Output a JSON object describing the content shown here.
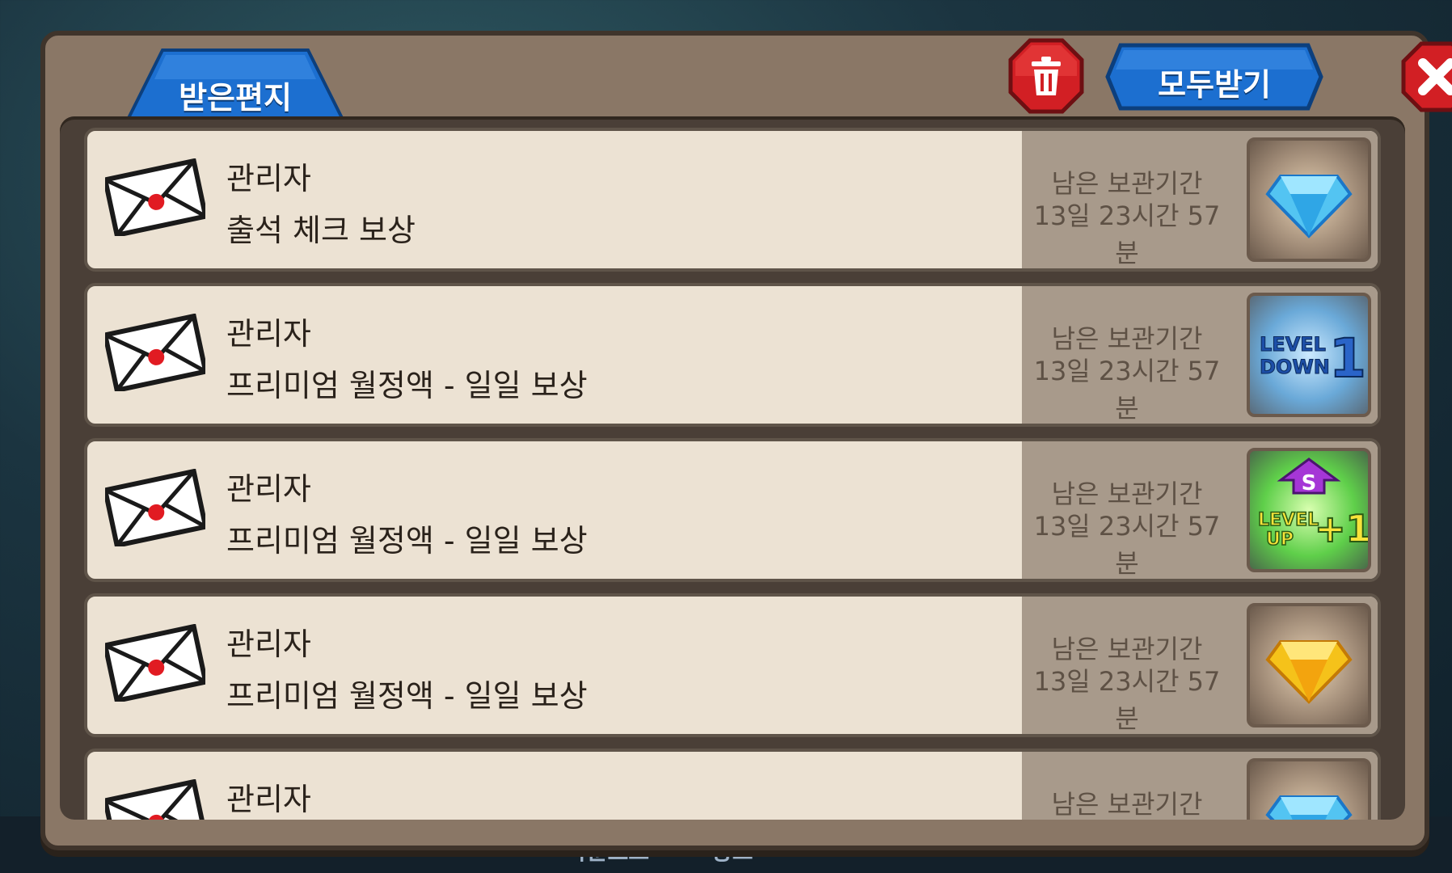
{
  "header": {
    "tab_label": "받은편지",
    "receive_all_label": "모두받기"
  },
  "colors": {
    "panel": "#8a7766",
    "item_bg": "#ece2d3",
    "item_side": "#a89a8b",
    "tab_blue": "#1c6fd0",
    "button_red": "#d21f24"
  },
  "mails": [
    {
      "sender": "관리자",
      "subject": "출석 체크 보상",
      "remain_title": "남은 보관기간",
      "remain_time": "13일 23시간 57분",
      "reward_icon": "blue-diamond-icon"
    },
    {
      "sender": "관리자",
      "subject": "프리미엄 월정액 - 일일 보상",
      "remain_title": "남은 보관기간",
      "remain_time": "13일 23시간 57분",
      "reward_icon": "level-down-icon",
      "reward_text": [
        "LEVEL",
        "DOWN",
        "1"
      ]
    },
    {
      "sender": "관리자",
      "subject": "프리미엄 월정액 - 일일 보상",
      "remain_title": "남은 보관기간",
      "remain_time": "13일 23시간 57분",
      "reward_icon": "level-up-icon",
      "reward_text": [
        "S",
        "LEVEL",
        "UP",
        "+1"
      ]
    },
    {
      "sender": "관리자",
      "subject": "프리미엄 월정액 - 일일 보상",
      "remain_title": "남은 보관기간",
      "remain_time": "13일 23시간 57분",
      "reward_icon": "yellow-diamond-icon"
    },
    {
      "sender": "관리자",
      "subject": "",
      "remain_title": "남은 보관기간",
      "remain_time": "",
      "reward_icon": "blue-diamond-icon"
    }
  ],
  "background": {
    "bottom_texts": [
      "다운로드",
      "광고"
    ]
  }
}
